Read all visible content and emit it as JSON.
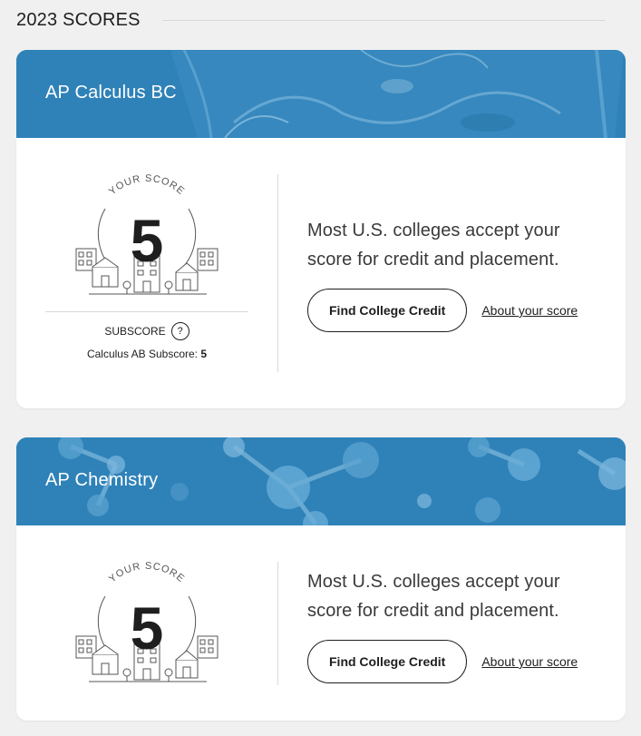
{
  "section": {
    "title": "2023 SCORES"
  },
  "colors": {
    "banner": "#2f82b8",
    "text": "#1e1e1e",
    "divider": "#d9d9d9",
    "page_bg": "#f0f0f0"
  },
  "cards": [
    {
      "banner_title": "AP Calculus BC",
      "banner_image": "water-glass-photo",
      "badge_label": "YOUR SCORE",
      "score": "5",
      "subscore_label": "SUBSCORE",
      "subscore_help": "?",
      "subscore_name": "Calculus AB Subscore:",
      "subscore_value": "5",
      "info_text": "Most U.S. colleges accept your score for credit and placement.",
      "credit_button": "Find College Credit",
      "about_link": "About your score"
    },
    {
      "banner_title": "AP Chemistry",
      "banner_image": "molecule-photo",
      "badge_label": "YOUR SCORE",
      "score": "5",
      "info_text": "Most U.S. colleges accept your score for credit and placement.",
      "credit_button": "Find College Credit",
      "about_link": "About your score"
    }
  ]
}
